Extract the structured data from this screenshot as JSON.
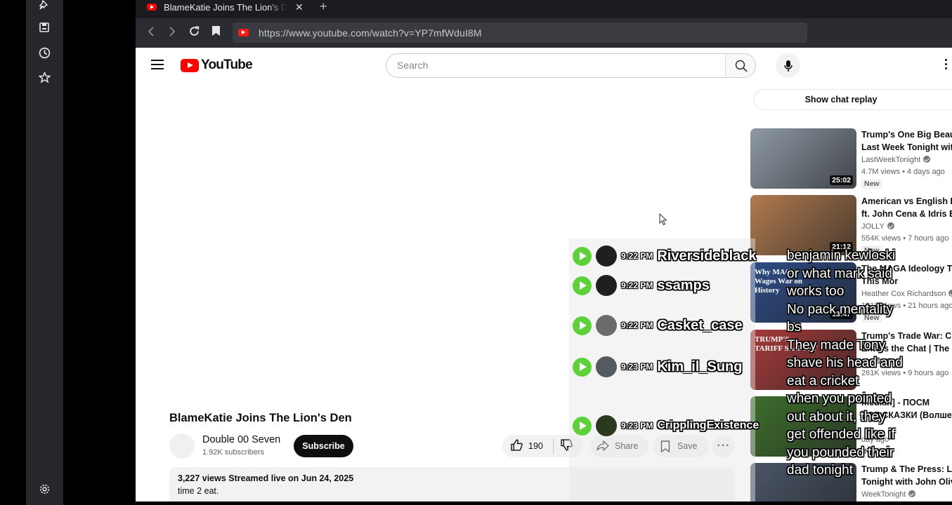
{
  "tab": {
    "title": "BlameKatie Joins The Lion's Den",
    "close": "✕",
    "new": "+"
  },
  "address": {
    "url": "https://www.youtube.com/watch?v=YP7mfWduI8M"
  },
  "yt": {
    "logo_text": "YouTube",
    "search_placeholder": "Search",
    "show_chat": "Show chat replay"
  },
  "video": {
    "title": "BlameKatie Joins The Lion's Den",
    "channel": "Double 00 Seven",
    "subscribers": "1.92K subscribers",
    "subscribe": "Subscribe",
    "likes": "190",
    "share": "Share",
    "save": "Save",
    "more": "···",
    "stats": "3,227 views  Streamed live on Jun 24, 2025",
    "description": "time 2 eat."
  },
  "recommendations": [
    {
      "title": "Trump's One Big Beauti",
      "title2": "Last Week Tonight with",
      "channel": "LastWeekTonight",
      "meta": "4.7M views  •  4 days ago",
      "badge": "New",
      "duration": "25:02",
      "thumb": "#8f9aa6"
    },
    {
      "title": "American vs English Br",
      "title2": "ft. John Cena & Idris Ell",
      "channel": "JOLLY",
      "meta": "554K views  •  7 hours ago",
      "badge": "New",
      "duration": "21:12",
      "thumb": "#b07a4e"
    },
    {
      "title": "The MAGA Ideology Th",
      "title2": "This Mor",
      "channel": "Heather Cox Richardson",
      "meta": "101K views  •  21 hours ago",
      "badge": "New",
      "duration": "13:47",
      "thumb": "#2d4c86",
      "thumb_text": "Why MAGA Wages War on History"
    },
    {
      "title": "Trump's Trade War: Chi",
      "title2": "Enters the Chat | The D",
      "channel": "ow",
      "meta": "261K views  •  9 hours ago",
      "badge": "",
      "duration": "",
      "thumb": "#a63a3a",
      "thumb_text": "TRUMP'S TARIFF SAGA PT"
    },
    {
      "title": "median] - ПОСМ",
      "title2": "ВСЕ СКАЗКИ (Волшеб",
      "channel": "",
      "meta": "day ago",
      "badge": "New",
      "duration": "",
      "thumb": "#3d6e2c"
    },
    {
      "title": "Trump & The Press: Las",
      "title2": "Tonight with John Olive",
      "channel": "WeekTonight",
      "meta": "",
      "badge": "",
      "duration": "",
      "thumb": "#4a5568"
    }
  ],
  "chat_overlay": [
    {
      "time": "9:22 PM",
      "user": "Riversideblack",
      "avatar": "#1f1f1f"
    },
    {
      "time": "9:22 PM",
      "user": "ssamps",
      "avatar": "#1f1f1f"
    },
    {
      "time": "9:22 PM",
      "user": "Casket_case",
      "avatar": "#6b6b6b"
    },
    {
      "time": "9:23 PM",
      "user": "Kim_il_Sung",
      "avatar": "#555a60"
    },
    {
      "time": "9:23 PM",
      "user": "CripplingExistence",
      "avatar": "#2b3a1e"
    }
  ],
  "overlay_messages": [
    "benjamin kewloski",
    "or what mark said",
    "works too",
    "No pack mentality",
    "bs",
    "They made Tony",
    "shave his head and",
    "eat a cricket",
    "when you pointed",
    "out about it, they",
    "get offended like if",
    "you pounded their",
    "dad tonight"
  ],
  "colors": {
    "youtube_red": "#ff0000",
    "chat_play_green": "#5ed13a",
    "browser_dark": "#2b2c31"
  }
}
